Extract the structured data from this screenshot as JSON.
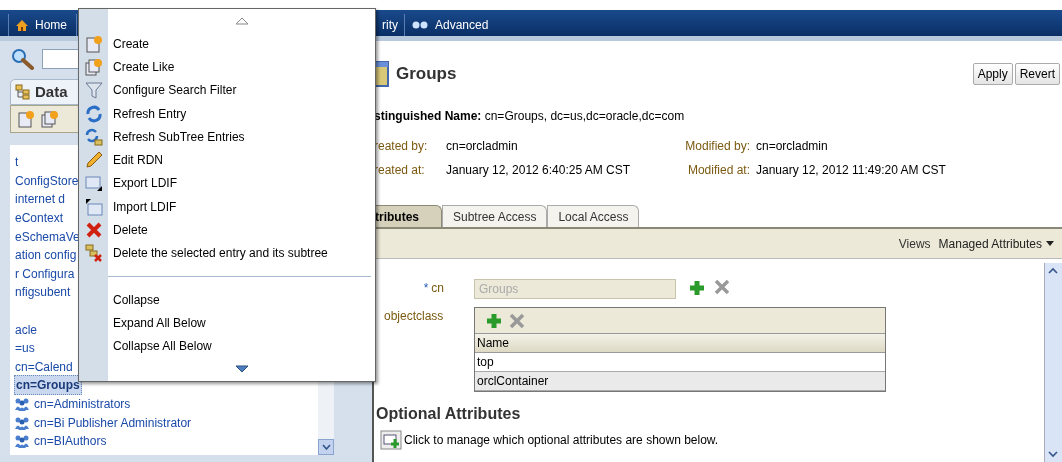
{
  "nav_tabs": [
    {
      "label": "Home"
    },
    {
      "label": "rity"
    },
    {
      "label": "Advanced"
    }
  ],
  "left_panel": {
    "tab": "Data",
    "tree": [
      {
        "label": "t",
        "selected": false
      },
      {
        "label": "ConfigStore",
        "selected": false
      },
      {
        "label": "internet d",
        "selected": false
      },
      {
        "label": "eContext",
        "selected": false
      },
      {
        "label": "eSchemaVe",
        "selected": false
      },
      {
        "label": "ation config",
        "selected": false
      },
      {
        "label": "r Configura",
        "selected": false
      },
      {
        "label": "nfigsubent",
        "selected": false
      },
      {
        "label": "acle",
        "selected": false
      },
      {
        "label": "=us",
        "selected": false
      },
      {
        "label": "cn=Calend",
        "selected": false
      },
      {
        "label": "cn=Groups",
        "selected": true,
        "children": [
          {
            "label": "cn=Administrators",
            "selected": false
          },
          {
            "label": "cn=Bi Publisher Administrator",
            "selected": false
          },
          {
            "label": "cn=BIAuthors",
            "selected": false
          }
        ]
      }
    ]
  },
  "context_menu": {
    "sections": [
      [
        "Create",
        "Create Like",
        "Configure Search Filter",
        "Refresh Entry",
        "Refresh SubTree Entries",
        "Edit RDN",
        "Export LDIF",
        "Import LDIF",
        "Delete",
        "Delete the selected entry and its subtree"
      ],
      [
        "Collapse",
        "Expand All Below",
        "Collapse All Below"
      ]
    ]
  },
  "entry": {
    "title": "Groups",
    "buttons": [
      "Apply",
      "Revert"
    ],
    "distinguished_name": "**stinguished Name:** cn=Groups, dc=us,dc=oracle,dc=com",
    "meta": [
      {
        "label": "reated by:",
        "value": "cn=orcladmin"
      },
      {
        "label": "Modified by:",
        "value": "cn=orcladmin"
      },
      {
        "label": "reated at:",
        "value": "January 12, 2012 6:40:25 AM CST"
      },
      {
        "label": "Modified at:",
        "value": "January 12, 2012 11:49:20 AM CST"
      }
    ],
    "tabs": [
      {
        "label": "tributes",
        "selected": true
      },
      {
        "label": "Subtree Access",
        "selected": false
      },
      {
        "label": "Local Access",
        "selected": false
      }
    ],
    "views": {
      "label": "Views",
      "menu": "Managed Attributes"
    },
    "cn": {
      "label": "cn",
      "required_mark": "*",
      "value": "Groups",
      "disabled": true
    },
    "objectclass": {
      "label": "objectclass",
      "column": "Name",
      "rows": [
        "top",
        "orclContainer"
      ]
    },
    "optional": {
      "heading": "Optional Attributes",
      "link": "Click to manage which optional attributes are shown below."
    }
  }
}
